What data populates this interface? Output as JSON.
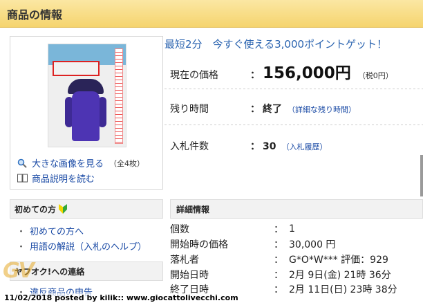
{
  "header": {
    "title": "商品の情報"
  },
  "promo": "最短2分　今すぐ使える3,000ポイントゲット！",
  "price": {
    "label": "現在の価格",
    "colon": "：",
    "value": "156,000円",
    "tax": "（税0円）"
  },
  "remaining": {
    "label": "残り時間",
    "colon": "：",
    "value": "終了",
    "link": "（詳細な残り時間）"
  },
  "bids": {
    "label": "入札件数",
    "colon": "：",
    "value": "30",
    "link": "（入札履歴）"
  },
  "image_links": {
    "enlarge": "大きな画像を見る",
    "count": "（全4枚）",
    "description": "商品説明を読む"
  },
  "beginner": {
    "title": "初めての方",
    "items": [
      "初めての方へ",
      "用語の解説（入札のヘルプ）"
    ]
  },
  "contact": {
    "title": "ヤフオク!への連絡",
    "items": [
      "違反商品の申告"
    ]
  },
  "details": {
    "title": "詳細情報",
    "rows": [
      {
        "label": "個数",
        "colon": "：",
        "value": "1"
      },
      {
        "label": "開始時の価格",
        "colon": "：",
        "value": "30,000 円"
      },
      {
        "label": "落札者",
        "colon": "：",
        "value": "G*O*W*** 評価：929"
      },
      {
        "label": "開始日時",
        "colon": "：",
        "value": "2月 9日(金) 21時 36分"
      },
      {
        "label": "終了日時",
        "colon": "：",
        "value": "2月 11日(日) 23時 38分"
      }
    ]
  },
  "watermark": "GV",
  "footer": "11/02/2018 posted by kilik:: www.giocattolivecchi.com",
  "icons": {
    "search": "magnifier-icon",
    "book": "book-icon",
    "beginner": "beginner-mark-icon"
  },
  "colors": {
    "header_bg": "#f5d46e",
    "link": "#1a4aa5",
    "promo": "#2b64b0"
  }
}
